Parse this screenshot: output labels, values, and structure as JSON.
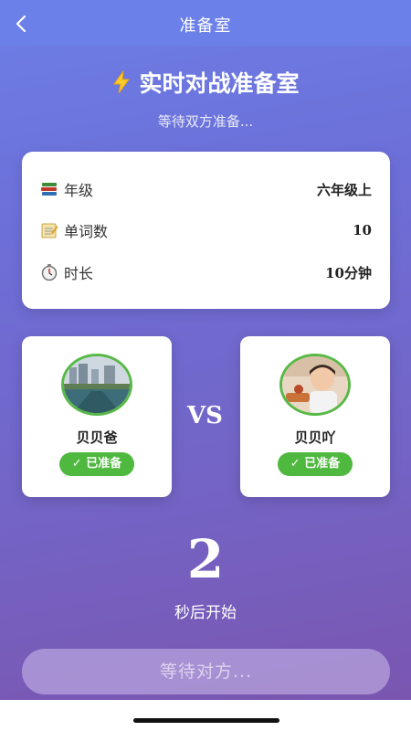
{
  "nav": {
    "title": "准备室",
    "back_icon": "chevron-left-icon"
  },
  "hero": {
    "icon": "lightning-icon",
    "title": "实时对战准备室",
    "subtitle": "等待双方准备..."
  },
  "info": [
    {
      "icon": "books-icon",
      "label": "年级",
      "value": "六年级上"
    },
    {
      "icon": "notepad-icon",
      "label": "单词数",
      "value": "10"
    },
    {
      "icon": "stopwatch-icon",
      "label": "时长",
      "value": "10分钟"
    }
  ],
  "players": [
    {
      "name": "贝贝爸",
      "status": "✓ 已准备"
    },
    {
      "name": "贝贝吖",
      "status": "✓ 已准备"
    }
  ],
  "vs_label": "VS",
  "countdown": {
    "value": "2",
    "label": "秒后开始"
  },
  "action_button": {
    "label": "等待对方..."
  },
  "colors": {
    "accent": "#6c80ea",
    "ready": "#4fb83f"
  }
}
